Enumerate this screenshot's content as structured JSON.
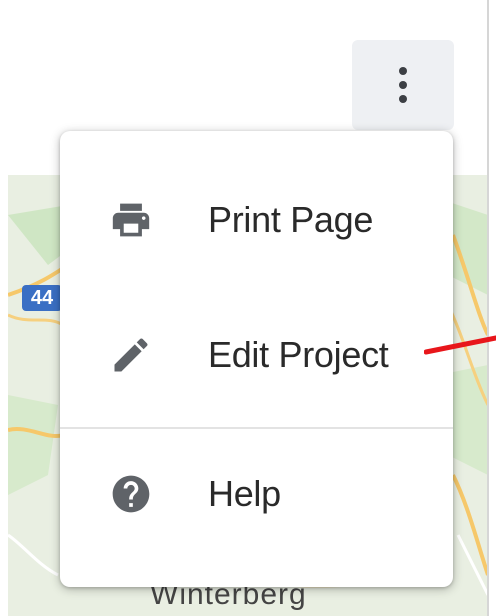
{
  "toolbar": {
    "more_button_icon": "more-vert-icon"
  },
  "menu": {
    "items": [
      {
        "label": "Print Page",
        "icon": "print-icon"
      },
      {
        "label": "Edit Project",
        "icon": "edit-pencil-icon"
      },
      {
        "label": "Help",
        "icon": "help-circle-icon"
      }
    ]
  },
  "map": {
    "road_badge": "44",
    "town_label": "Winterberg"
  },
  "colors": {
    "menu_text": "#2a2a2a",
    "icon": "#5f6368",
    "button_bg": "#eef0f3",
    "annotation_arrow": "#e8161b",
    "map_bg": "#e9efe2"
  }
}
